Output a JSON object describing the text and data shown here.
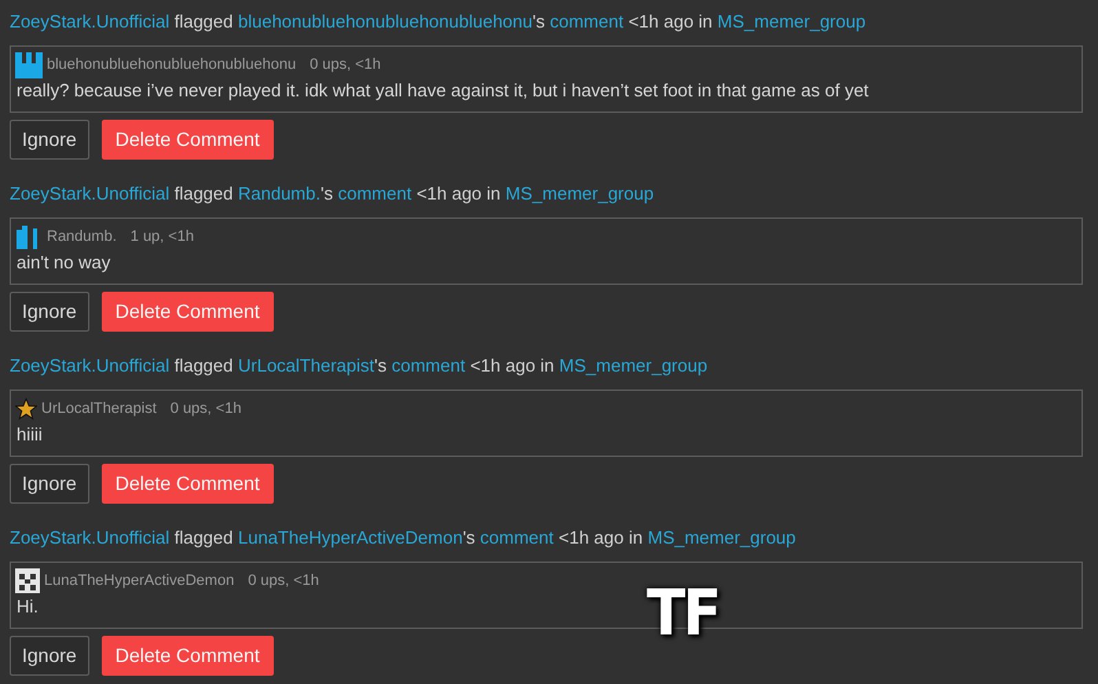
{
  "flags": [
    {
      "flagger": "ZoeyStark.Unofficial",
      "verb": "flagged",
      "user": "bluehonubluehonubluehonubluehonu",
      "possessive": "'s",
      "comment_link": "comment",
      "when": "<1h ago in",
      "group": "MS_memer_group",
      "avatar": {
        "kind": "blocks"
      },
      "author": "bluehonubluehonubluehonubluehonu",
      "meta": "0 ups, <1h",
      "body": "really? because i’ve never played it. idk what yall have against it, but i haven’t set foot in that game as of yet",
      "buttons": [
        "Ignore",
        "Delete Comment"
      ]
    },
    {
      "flagger": "ZoeyStark.Unofficial",
      "verb": "flagged",
      "user": "Randumb.",
      "possessive": "'s",
      "comment_link": "comment",
      "when": "<1h ago in",
      "group": "MS_memer_group",
      "avatar": {
        "kind": "bars"
      },
      "author": "Randumb.",
      "meta": "1 up, <1h",
      "body": "ain't no way",
      "buttons": [
        "Ignore",
        "Delete Comment"
      ]
    },
    {
      "flagger": "ZoeyStark.Unofficial",
      "verb": "flagged",
      "user": "UrLocalTherapist",
      "possessive": "'s",
      "comment_link": "comment",
      "when": "<1h ago in",
      "group": "MS_memer_group",
      "avatar": {
        "kind": "star"
      },
      "author": "UrLocalTherapist",
      "meta": "0 ups, <1h",
      "body": "hiiii",
      "buttons": [
        "Ignore",
        "Delete Comment"
      ]
    },
    {
      "flagger": "ZoeyStark.Unofficial",
      "verb": "flagged",
      "user": "LunaTheHyperActiveDemon",
      "possessive": "'s",
      "comment_link": "comment",
      "when": "<1h ago in",
      "group": "MS_memer_group",
      "avatar": {
        "kind": "pixel"
      },
      "author": "LunaTheHyperActiveDemon",
      "meta": "0 ups, <1h",
      "body": "Hi.",
      "buttons": [
        "Ignore",
        "Delete Comment"
      ]
    }
  ],
  "caption": "TF"
}
